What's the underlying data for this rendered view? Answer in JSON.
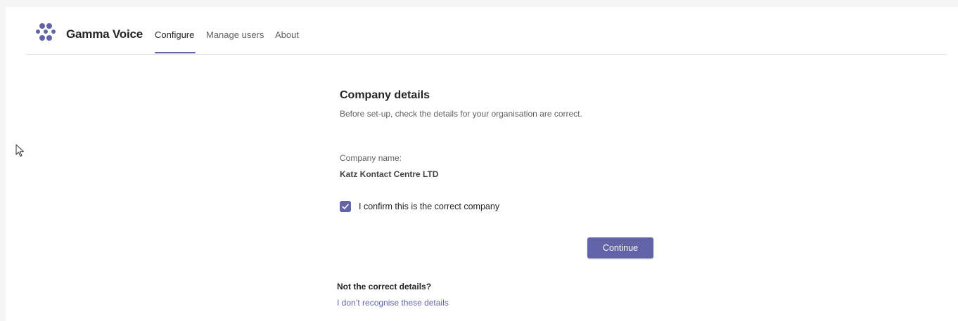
{
  "header": {
    "app_title": "Gamma Voice",
    "logo_icon": "gamma-dots-logo",
    "accent_color": "#6264a7",
    "tabs": [
      {
        "label": "Configure",
        "active": true
      },
      {
        "label": "Manage users",
        "active": false
      },
      {
        "label": "About",
        "active": false
      }
    ]
  },
  "main": {
    "title": "Company details",
    "subtitle": "Before set-up, check the details for your organisation are correct.",
    "company_label": "Company name:",
    "company_value": "Katz Kontact Centre LTD",
    "confirm_checkbox": {
      "label": "I confirm this is the correct company",
      "checked": true
    },
    "continue_label": "Continue",
    "not_correct_title": "Not the correct details?",
    "not_recognise_link": "I don’t recognise these details"
  }
}
